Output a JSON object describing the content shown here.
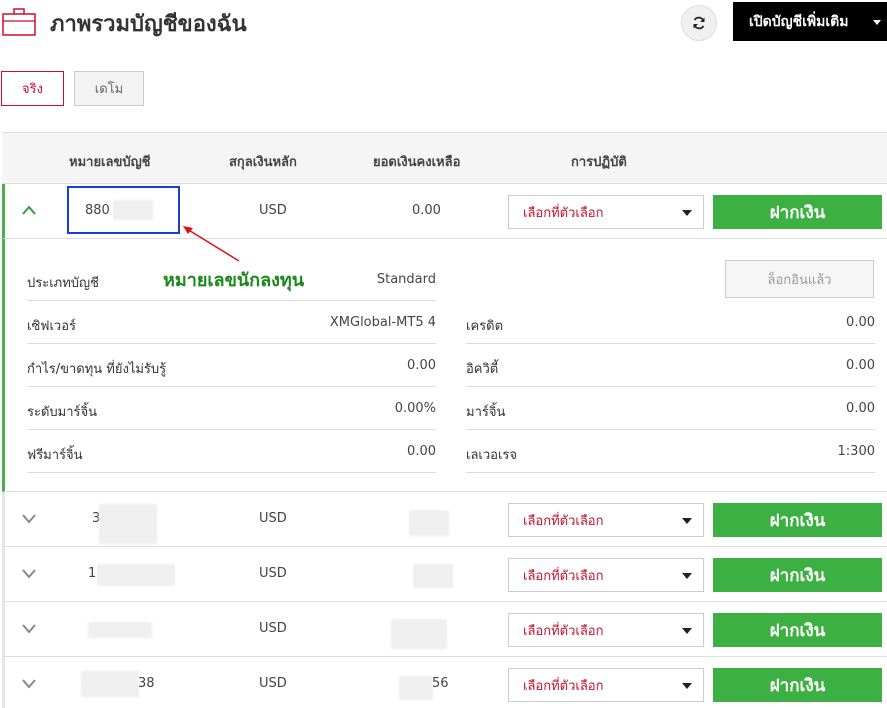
{
  "header": {
    "title": "ภาพรวมบัญชีของฉัน",
    "open_account_label": "เปิดบัญชีเพิ่มเติม",
    "icons": {
      "briefcase": "briefcase-icon",
      "refresh": "refresh-icon"
    }
  },
  "tabs": {
    "real": "จริง",
    "demo": "เดโม"
  },
  "table": {
    "headers": {
      "account": "หมายเลขบัญชี",
      "currency": "สกุลเงินหลัก",
      "balance": "ยอดเงินคงเหลือ",
      "actions": "การปฏิบัติ"
    },
    "select_placeholder": "เลือกที่ตัวเลือก",
    "deposit_label": "ฝากเงิน",
    "rows": [
      {
        "account": "880",
        "currency": "USD",
        "balance": "0.00"
      },
      {
        "account": "3",
        "currency": "USD",
        "balance": ""
      },
      {
        "account": "1",
        "currency": "USD",
        "balance": ""
      },
      {
        "account": "",
        "currency": "USD",
        "balance": ""
      },
      {
        "account": "38",
        "currency": "USD",
        "balance": "56"
      }
    ]
  },
  "details": {
    "annotation": "หมายเลขนักลงทุน",
    "logged_in_label": "ล็อกอินแล้ว",
    "left": [
      {
        "label": "ประเภทบัญชี",
        "value": "Standard"
      },
      {
        "label": "เซิฟเวอร์",
        "value": "XMGlobal-MT5 4"
      },
      {
        "label": "กำไร/ขาดทุน ที่ยังไม่รับรู้",
        "value": "0.00"
      },
      {
        "label": "ระดับมาร์จิ้น",
        "value": "0.00%"
      },
      {
        "label": "ฟรีมาร์จิ้น",
        "value": "0.00"
      }
    ],
    "right": [
      {
        "label": "เครดิต",
        "value": "0.00"
      },
      {
        "label": "อิควิตี้",
        "value": "0.00"
      },
      {
        "label": "มาร์จิ้น",
        "value": "0.00"
      },
      {
        "label": "เลเวอเรจ",
        "value": "1:300"
      }
    ]
  },
  "colors": {
    "accent_red": "#c8102e",
    "deposit_green": "#3cb043",
    "annotation_green": "#1a8a1a",
    "highlight_blue": "#1a3fd0",
    "black": "#000000"
  }
}
